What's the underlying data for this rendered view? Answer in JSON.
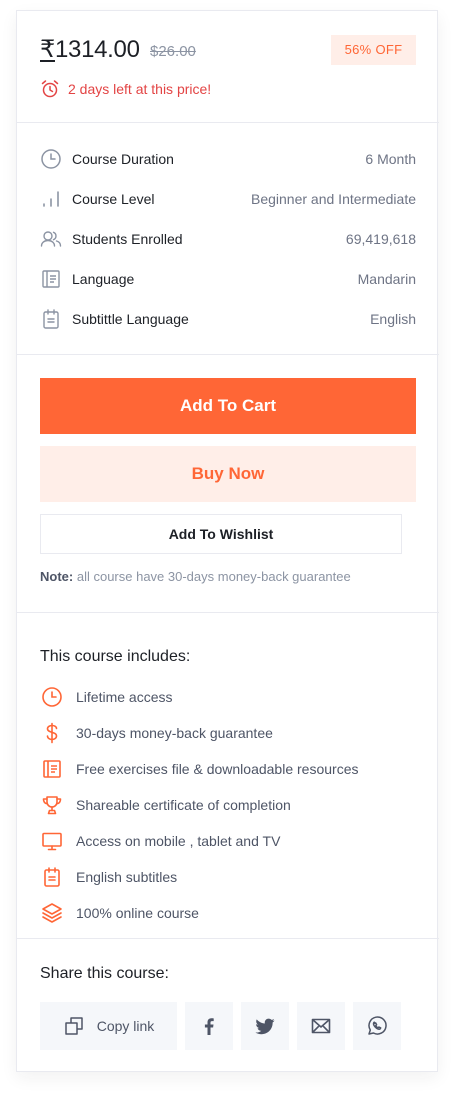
{
  "pricing": {
    "currency_symbol": "₹",
    "current_price": "1314.00",
    "original_price": "$26.00",
    "discount": "56% OFF",
    "deadline": "2 days left at this price!",
    "icons": {
      "deadline": "alarm-clock-icon"
    }
  },
  "details": [
    {
      "icon": "clock-icon",
      "label": "Course Duration",
      "value": "6 Month"
    },
    {
      "icon": "bar-chart-icon",
      "label": "Course Level",
      "value": "Beginner and Intermediate"
    },
    {
      "icon": "users-icon",
      "label": "Students Enrolled",
      "value": "69,419,618"
    },
    {
      "icon": "notebook-icon",
      "label": "Language",
      "value": "Mandarin"
    },
    {
      "icon": "notepad-icon",
      "label": "Subtittle Language",
      "value": "English"
    }
  ],
  "actions": {
    "add_to_cart": "Add To Cart",
    "buy_now": "Buy Now",
    "add_to_wishlist": "Add To Wishlist",
    "note_label": "Note:",
    "note_text": "all course have 30-days money-back guarantee"
  },
  "includes": {
    "title": "This course includes:",
    "items": [
      {
        "icon": "clock-icon",
        "text": "Lifetime access"
      },
      {
        "icon": "dollar-icon",
        "text": "30-days money-back guarantee"
      },
      {
        "icon": "file-icon",
        "text": "Free exercises file & downloadable resources"
      },
      {
        "icon": "trophy-icon",
        "text": "Shareable certificate of completion"
      },
      {
        "icon": "monitor-icon",
        "text": "Access on mobile , tablet and TV"
      },
      {
        "icon": "notepad-icon",
        "text": "English subtitles"
      },
      {
        "icon": "layers-icon",
        "text": "100% online course"
      }
    ]
  },
  "share": {
    "title": "Share this course:",
    "copy_link": "Copy link",
    "icons": [
      "copy-icon",
      "facebook-icon",
      "twitter-icon",
      "mail-icon",
      "whatsapp-icon"
    ]
  },
  "colors": {
    "accent": "#FF6636",
    "accent_light": "#FFEEE8",
    "warning": "#E34444",
    "text_dark": "#1D2026",
    "text_muted": "#6E7485",
    "border": "#E9EAF0"
  }
}
